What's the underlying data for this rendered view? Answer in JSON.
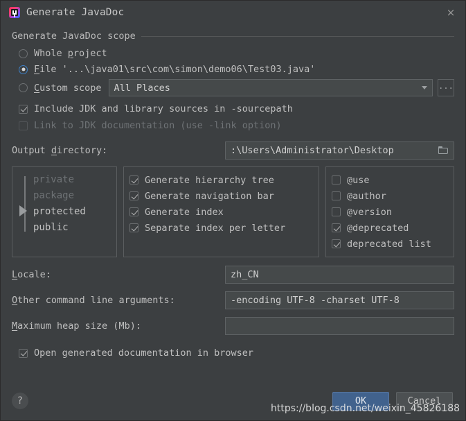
{
  "window": {
    "title": "Generate JavaDoc",
    "app_icon": "intellij-idea-icon",
    "close_icon": "×"
  },
  "scope": {
    "group_title": "Generate JavaDoc scope",
    "options": [
      {
        "label": "Whole project",
        "mnemonic": "p",
        "selected": false
      },
      {
        "label": "File '...\\java01\\src\\com\\simon\\demo06\\Test03.java'",
        "mnemonic": "F",
        "selected": true
      },
      {
        "label": "Custom scope",
        "mnemonic": "C",
        "selected": false
      }
    ],
    "custom_scope_value": "All Places",
    "browse_button_label": "...",
    "whole_project_prefix": "Whole ",
    "whole_project_suffix": "roject",
    "file_prefix": "",
    "file_suffix": "ile '...\\java01\\src\\com\\simon\\demo06\\Test03.java'",
    "custom_prefix": "",
    "custom_suffix": "ustom scope"
  },
  "options": {
    "include_jdk": {
      "label": "Include JDK and library sources in -sourcepath",
      "checked": true,
      "enabled": true
    },
    "link_jdk": {
      "label": "Link to JDK documentation (use -link option)",
      "checked": false,
      "enabled": false
    }
  },
  "output": {
    "label_pre": "Output ",
    "label_mn": "d",
    "label_post": "irectory:",
    "value": ":\\Users\\Administrator\\Desktop",
    "folder_icon": "folder-icon"
  },
  "visibility": {
    "items": [
      {
        "label": "private",
        "enabled": false
      },
      {
        "label": "package",
        "enabled": false
      },
      {
        "label": "protected",
        "enabled": true
      },
      {
        "label": "public",
        "enabled": true
      }
    ],
    "selected": "protected"
  },
  "generate": {
    "items": [
      {
        "label": "Generate hierarchy tree",
        "checked": true
      },
      {
        "label": "Generate navigation bar",
        "checked": true
      },
      {
        "label": "Generate index",
        "checked": true
      },
      {
        "label": "Separate index per letter",
        "checked": true
      }
    ]
  },
  "tags": {
    "items": [
      {
        "label": "@use",
        "checked": false
      },
      {
        "label": "@author",
        "checked": false
      },
      {
        "label": "@version",
        "checked": false
      },
      {
        "label": "@deprecated",
        "checked": true
      },
      {
        "label": "deprecated list",
        "checked": true
      }
    ]
  },
  "fields": {
    "locale": {
      "label_mn": "L",
      "label_rest": "ocale:",
      "value": "zh_CN",
      "placeholder": ""
    },
    "other_args": {
      "label_mn": "O",
      "label_rest": "ther command line arguments:",
      "value": "-encoding UTF-8 -charset UTF-8",
      "placeholder": ""
    },
    "max_heap": {
      "label_mn": "M",
      "label_rest": "aximum heap size (Mb):",
      "value": "",
      "placeholder": ""
    }
  },
  "open_doc": {
    "label": "Open generated documentation in browser",
    "checked": true
  },
  "footer": {
    "help_label": "?",
    "ok_label": "OK",
    "cancel_label": "Cancel"
  },
  "watermark": {
    "text": "https://blog.csdn.net/weixin_45826188"
  },
  "colors": {
    "background": "#3c3f41",
    "field_background": "#45494a",
    "accent_primary": "#41628d",
    "radio_accent": "#3d7fc4",
    "text": "#bfbfbf",
    "text_disabled": "#6f7376"
  }
}
